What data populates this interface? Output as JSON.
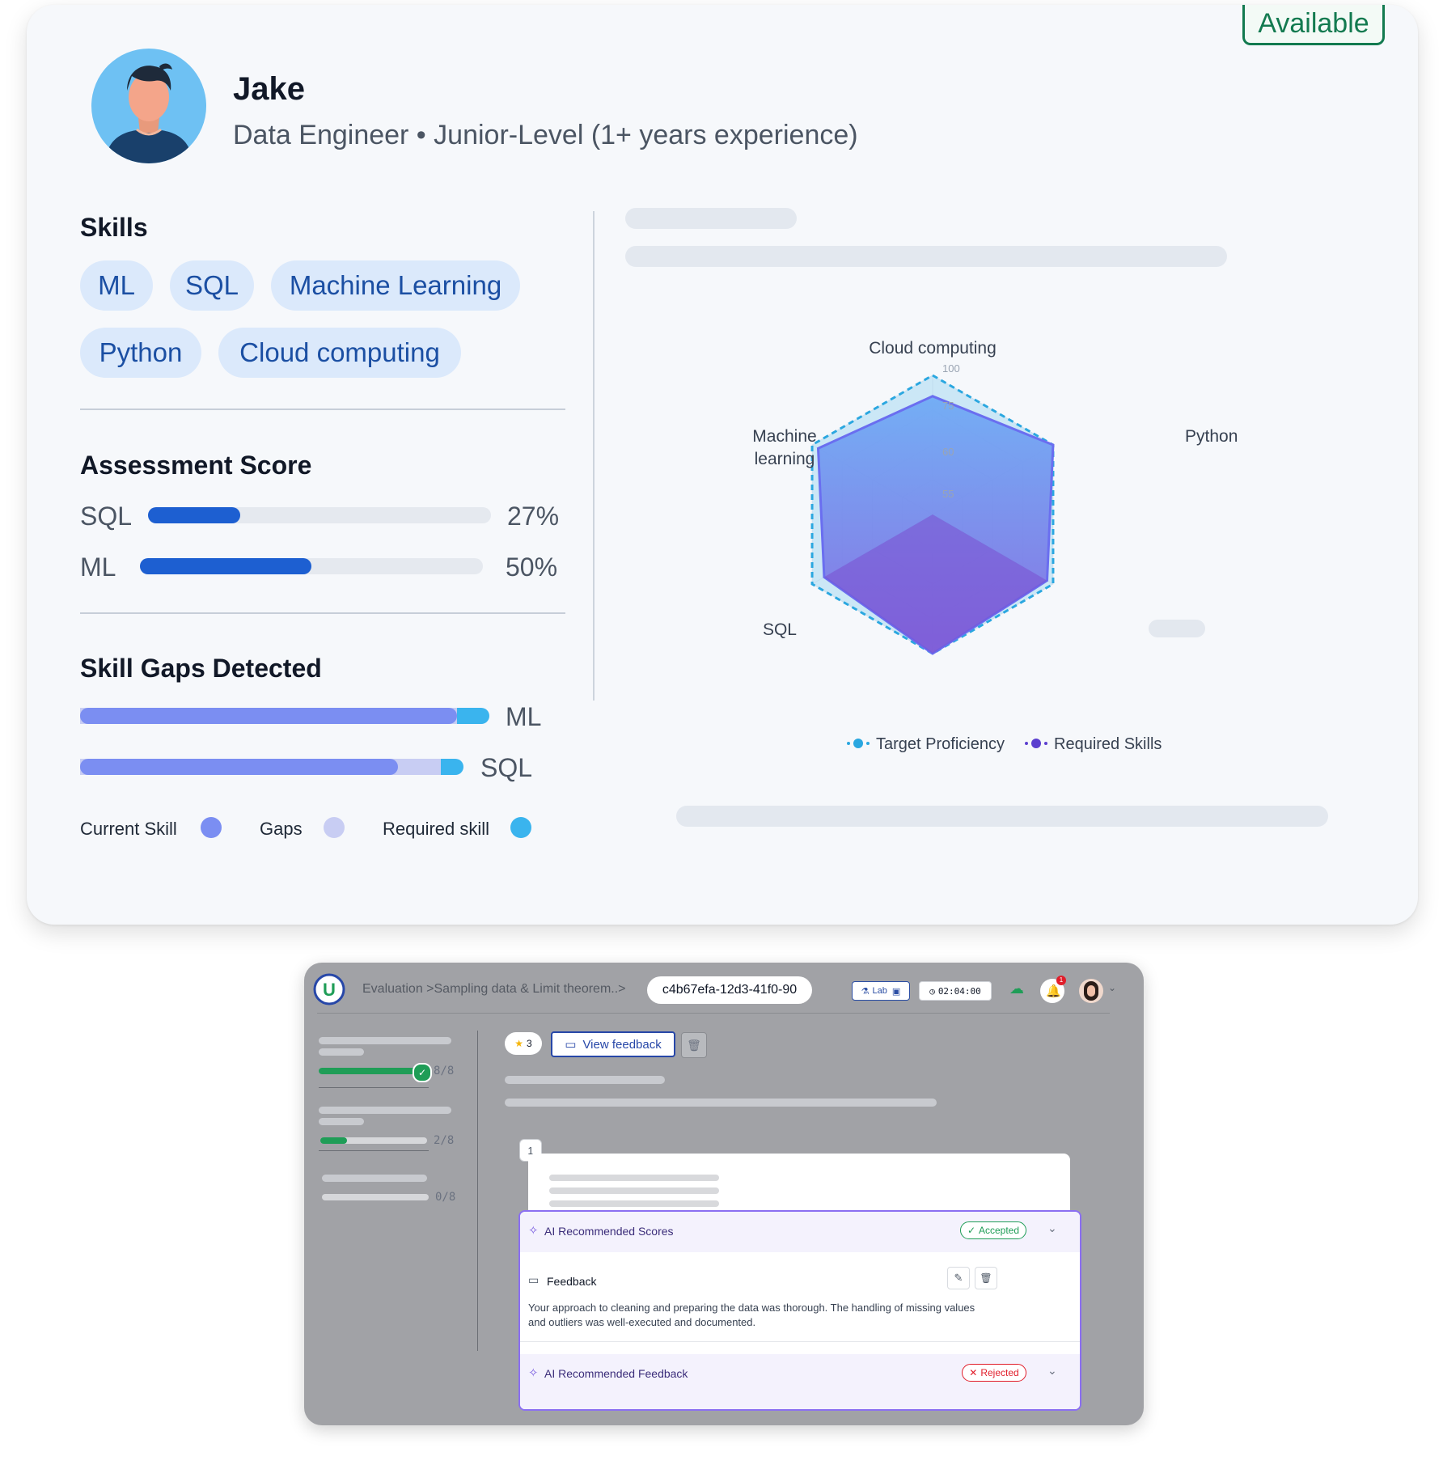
{
  "profile": {
    "status": "Available",
    "name": "Jake",
    "subtitle": "Data Engineer • Junior-Level (1+ years experience)"
  },
  "skills": {
    "heading": "Skills",
    "items": [
      "ML",
      "SQL",
      "Machine Learning",
      "Python",
      "Cloud computing"
    ]
  },
  "assessment": {
    "heading": "Assessment Score",
    "items": [
      {
        "label": "SQL",
        "value": 27,
        "display": "27%"
      },
      {
        "label": "ML",
        "value": 50,
        "display": "50%"
      }
    ]
  },
  "gaps": {
    "heading": "Skill Gaps Detected",
    "items": [
      {
        "label": "ML",
        "current": 0.92,
        "gap": 0.92,
        "required": 1.0
      },
      {
        "label": "SQL",
        "current": 0.83,
        "gap": 0.94,
        "required": 1.0
      }
    ],
    "legend": {
      "current": "Current Skill",
      "gaps": "Gaps",
      "required": "Required skill"
    },
    "colors": {
      "current": "#7b8ef2",
      "gaps": "#c8cdf3",
      "required": "#3ab4ee"
    }
  },
  "chart_data": {
    "type": "radar",
    "axes": [
      "Cloud computing",
      "Python",
      "",
      "",
      "SQL",
      "Machine learning"
    ],
    "axis_labels": {
      "cloud": "Cloud computing",
      "python": "Python",
      "sql": "SQL",
      "ml_line1": "Machine",
      "ml_line2": "learning"
    },
    "tick_labels": [
      "100",
      "75",
      "60",
      "55"
    ],
    "series": [
      {
        "name": "Target Proficiency",
        "values": [
          100,
          100,
          100,
          100,
          100,
          100
        ],
        "color": "#3ab4ee"
      },
      {
        "name": "Required Skills",
        "values": [
          85,
          100,
          95,
          100,
          90,
          95
        ],
        "color": "#5b4bd6"
      }
    ],
    "legend": [
      "Target Proficiency",
      "Required Skills"
    ]
  },
  "app": {
    "logo": "U",
    "breadcrumb": "Evaluation >Sampling data & Limit theorem..>",
    "session_id": "c4b67efa-12d3-41f0-90",
    "lab_label": "Lab",
    "timer": "02:04:00",
    "notifications": "1",
    "sidebar": {
      "progress": [
        {
          "text": "8/8",
          "value": 1.0
        },
        {
          "text": "2/8",
          "value": 0.25
        },
        {
          "text": "0/8",
          "value": 0.0
        }
      ]
    },
    "toolbar": {
      "star_count": "3",
      "view_feedback": "View feedback"
    },
    "question_number": "1",
    "ai_scores": {
      "title": "AI Recommended Scores",
      "status": "Accepted"
    },
    "feedback": {
      "title": "Feedback",
      "body": "Your approach to cleaning and preparing the data was thorough. The handling of missing values and outliers was well-executed and documented."
    },
    "ai_feedback": {
      "title": "AI Recommended Feedback",
      "status": "Rejected"
    }
  }
}
